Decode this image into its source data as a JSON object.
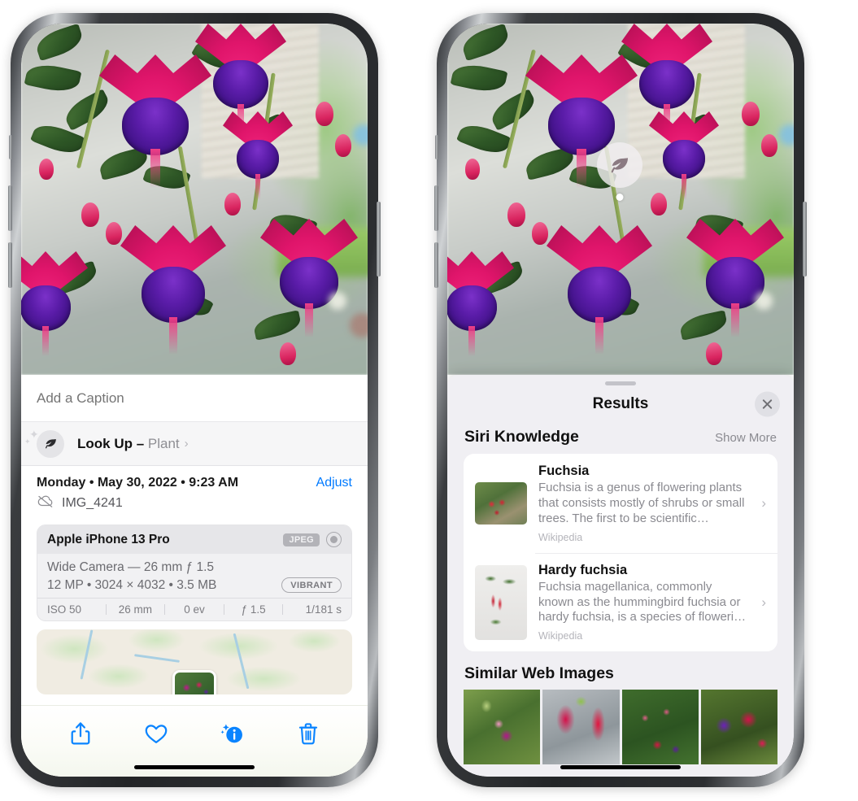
{
  "left_phone": {
    "caption": {
      "placeholder": "Add a Caption",
      "value": ""
    },
    "lookup": {
      "label": "Look Up",
      "dash": " – ",
      "subject": "Plant",
      "chevron": "›",
      "icon": "leaf-icon"
    },
    "meta": {
      "date": "Monday • May 30, 2022 • 9:23 AM",
      "adjust_label": "Adjust",
      "filename": "IMG_4241",
      "cloud_icon": "cloud-slash-icon"
    },
    "exif": {
      "device": "Apple iPhone 13 Pro",
      "format_badge": "JPEG",
      "lens_icon": "lens-icon",
      "lens_line": "Wide Camera — 26 mm ƒ 1.5",
      "spec_line": "12 MP • 3024 × 4032 • 3.5 MB",
      "vibrant_badge": "VIBRANT",
      "stats": [
        "ISO 50",
        "26 mm",
        "0 ev",
        "ƒ 1.5",
        "1/181 s"
      ]
    },
    "toolbar": [
      {
        "name": "share-icon",
        "label": "Share"
      },
      {
        "name": "heart-icon",
        "label": "Favorite"
      },
      {
        "name": "info-sparkle-icon",
        "label": "Info"
      },
      {
        "name": "trash-icon",
        "label": "Delete"
      }
    ]
  },
  "right_phone": {
    "visual_lookup_badge": {
      "icon": "leaf-icon"
    },
    "sheet": {
      "title": "Results",
      "close_icon": "close-icon",
      "siri_knowledge": {
        "heading": "Siri Knowledge",
        "show_more": "Show More",
        "cards": [
          {
            "title": "Fuchsia",
            "description": "Fuchsia is a genus of flowering plants that consists mostly of shrubs or small trees. The first to be scientific…",
            "source": "Wikipedia",
            "chevron": "›"
          },
          {
            "title": "Hardy fuchsia",
            "description": "Fuchsia magellanica, commonly known as the hummingbird fuchsia or hardy fuchsia, is a species of floweri…",
            "source": "Wikipedia",
            "chevron": "›"
          }
        ]
      },
      "similar_web_images": {
        "heading": "Similar Web Images",
        "thumbnails": [
          "fuchsia-pink-white",
          "fuchsia-red-closeup",
          "fuchsia-bush-buds",
          "fuchsia-purple-red"
        ]
      }
    }
  },
  "colors": {
    "accent_blue": "#007aff",
    "sheet_bg": "#f0eff3",
    "card_bg": "#ffffff",
    "secondary_text": "#8a8a90"
  }
}
